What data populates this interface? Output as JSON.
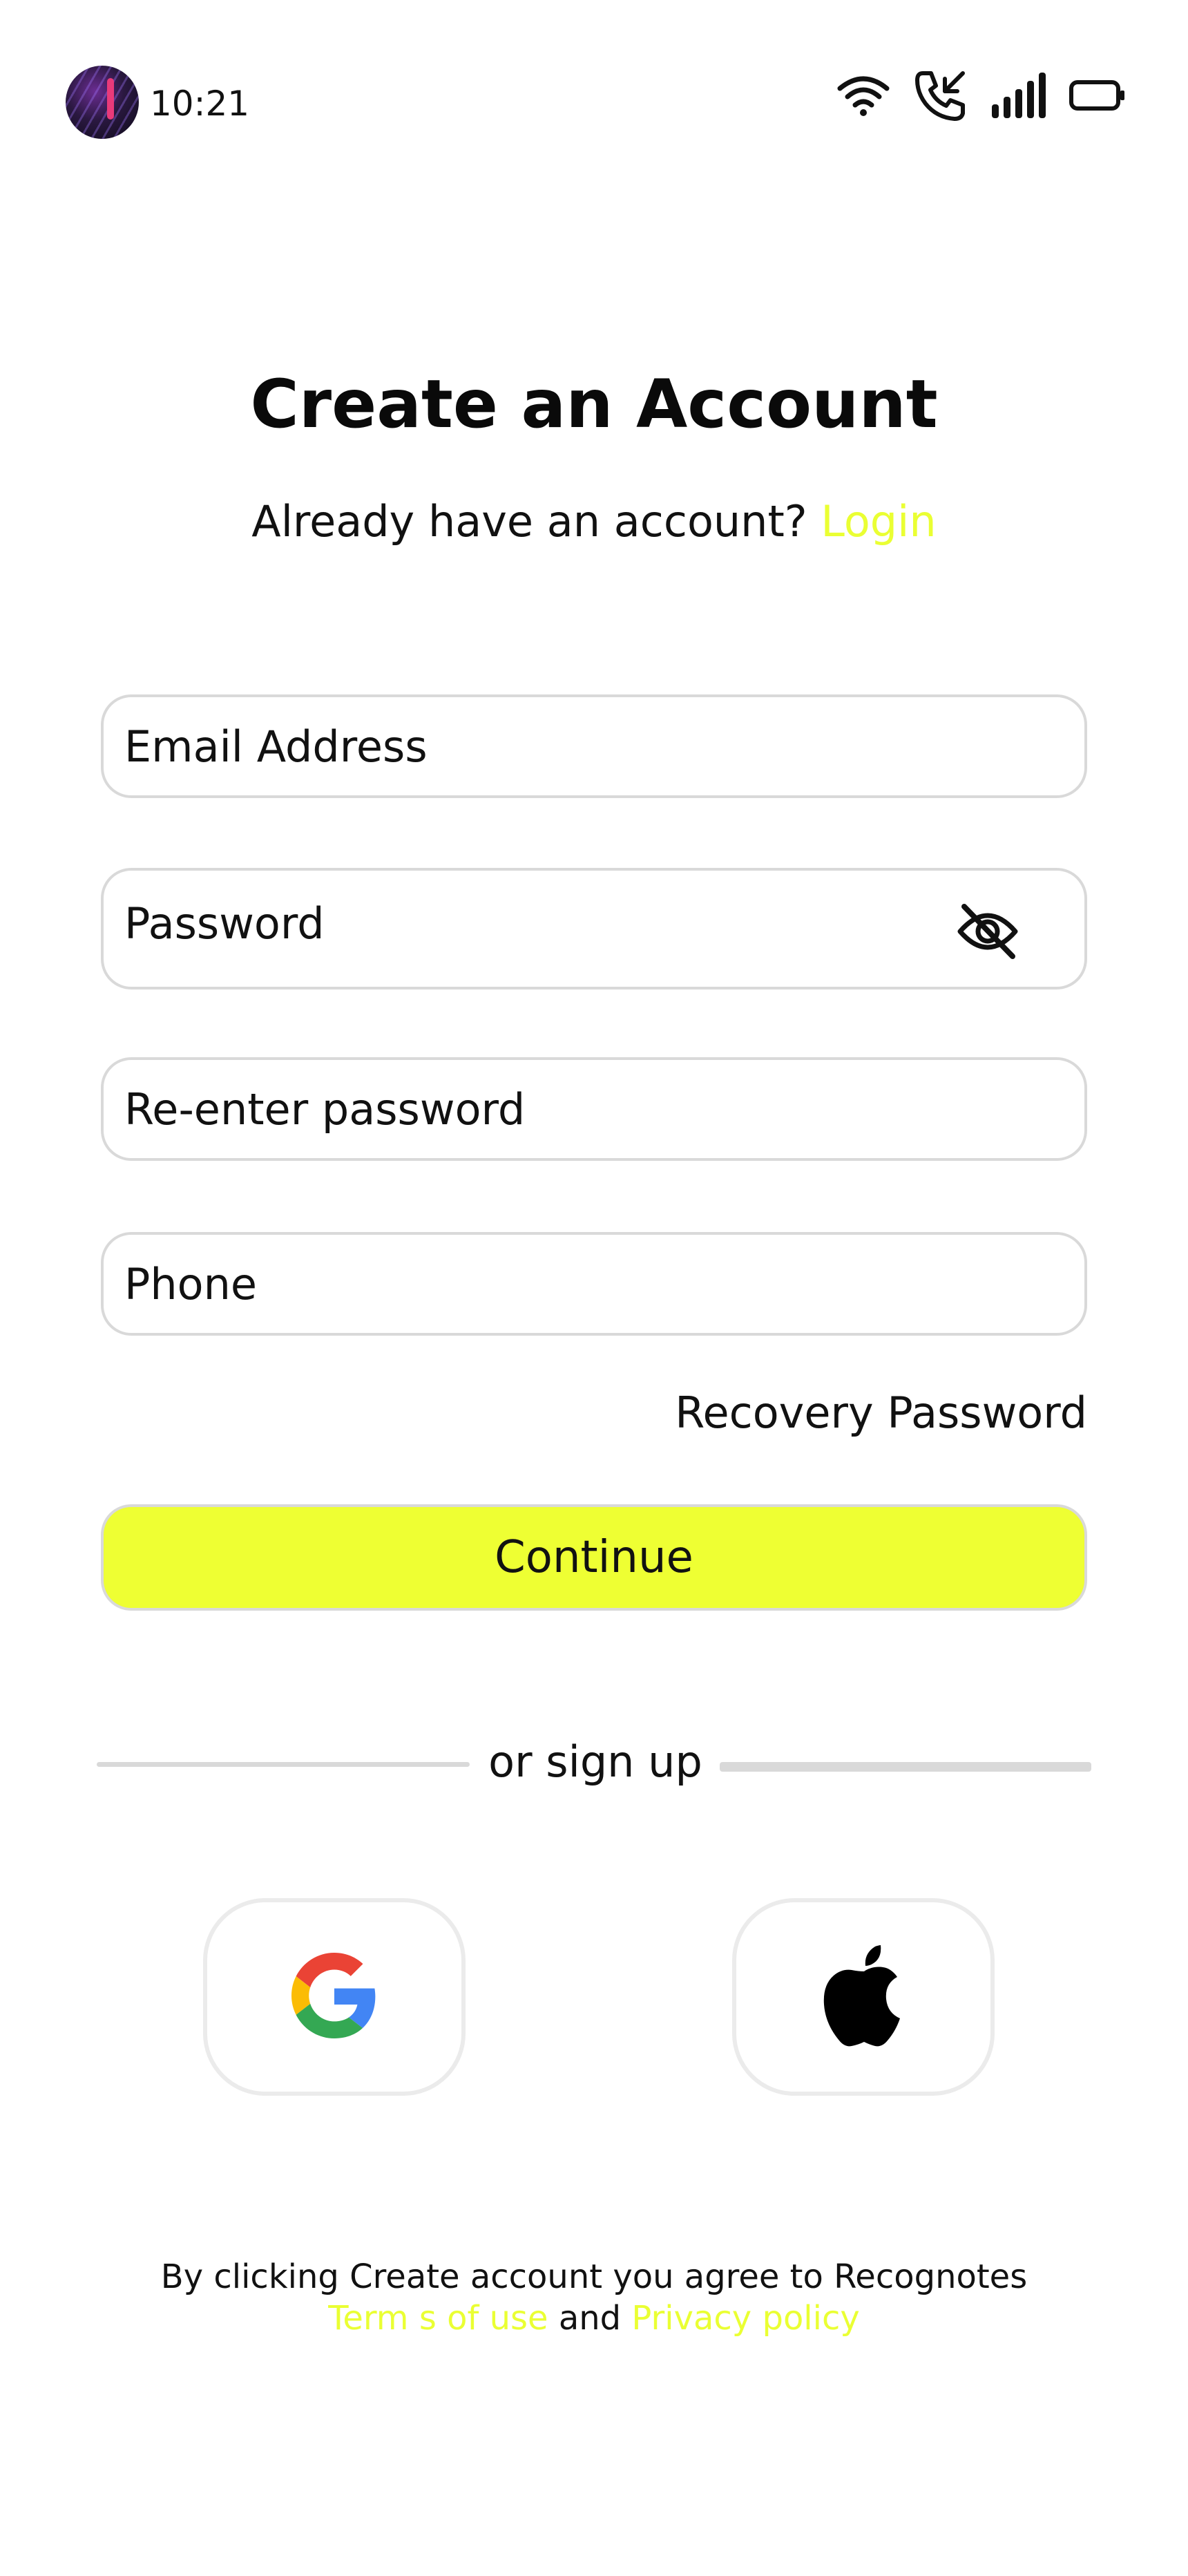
{
  "status_bar": {
    "time": "10:21",
    "icons": [
      "wifi-icon",
      "incoming-call-icon",
      "signal-icon",
      "battery-icon"
    ]
  },
  "header": {
    "title": "Create an Account",
    "prompt": "Already have an account?",
    "login_label": "Login"
  },
  "form": {
    "email_placeholder": "Email Address",
    "password_placeholder": "Password",
    "reenter_placeholder": "Re-enter password",
    "phone_placeholder": "Phone",
    "recovery_label": "Recovery Password",
    "continue_label": "Continue"
  },
  "social": {
    "divider_label": "or sign up",
    "providers": [
      "google-icon",
      "apple-icon"
    ]
  },
  "footer": {
    "line1": "By clicking Create account you agree to Recognotes",
    "terms_label": "Term s of use",
    "and": "and",
    "privacy_label": "Privacy policy"
  },
  "colors": {
    "accent": "#eeff33",
    "link": "#eaff33",
    "border": "#d9d9d9"
  }
}
